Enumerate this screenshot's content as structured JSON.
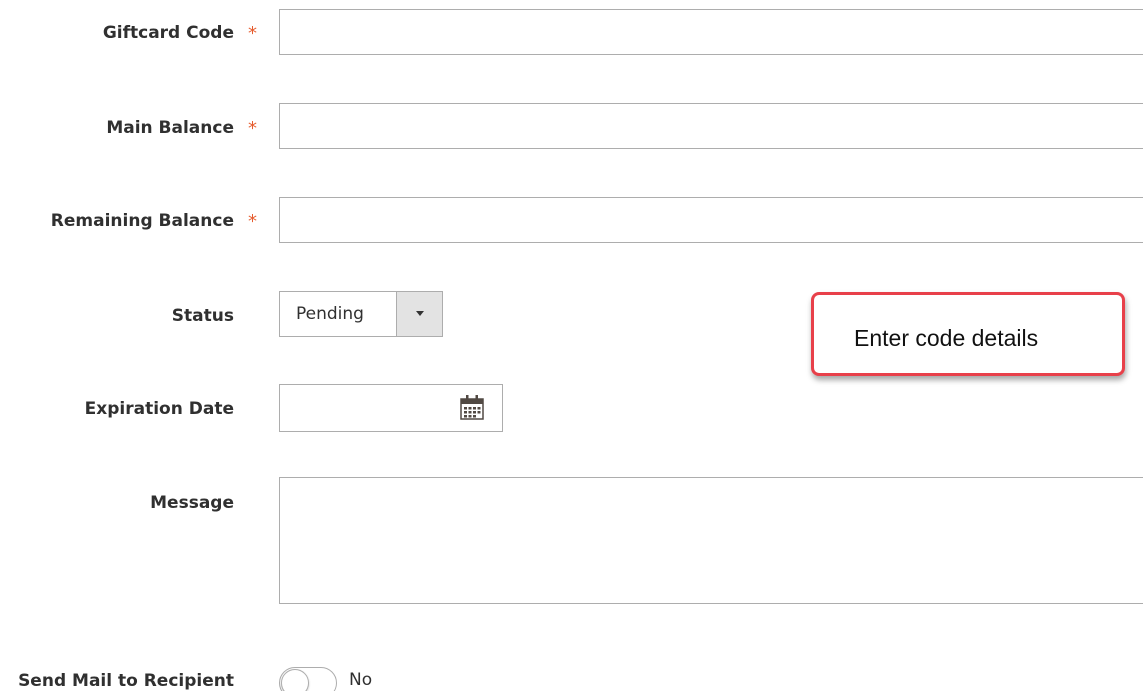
{
  "form": {
    "giftcard_code": {
      "label": "Giftcard Code",
      "required_mark": "*",
      "value": ""
    },
    "main_balance": {
      "label": "Main Balance",
      "required_mark": "*",
      "value": ""
    },
    "remaining_balance": {
      "label": "Remaining Balance",
      "required_mark": "*",
      "value": ""
    },
    "status": {
      "label": "Status",
      "selected": "Pending"
    },
    "expiration_date": {
      "label": "Expiration Date",
      "value": "",
      "icon": "calendar-icon"
    },
    "message": {
      "label": "Message",
      "value": ""
    },
    "send_mail": {
      "label": "Send Mail to Recipient",
      "state_text": "No",
      "enabled": false
    }
  },
  "annotation": {
    "text": "Enter code details",
    "border_color": "#e8404a"
  },
  "colors": {
    "required": "#e65c2e",
    "label": "#303030",
    "border": "#adadad",
    "select_button": "#e3e3e3"
  }
}
